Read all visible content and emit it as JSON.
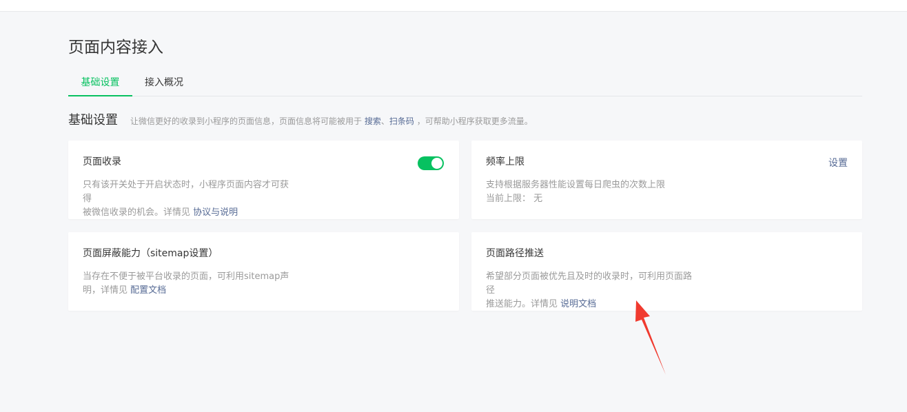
{
  "page_title": "页面内容接入",
  "tabs": [
    {
      "label": "基础设置",
      "active": true
    },
    {
      "label": "接入概况",
      "active": false
    }
  ],
  "section": {
    "title": "基础设置",
    "desc_prefix": "让微信更好的收录到小程序的页面信息，页面信息将可能被用于",
    "link_search": "搜索",
    "sep": "、",
    "link_scan": "扫条码",
    "desc_suffix": "，可帮助小程序获取更多流量。"
  },
  "cards": {
    "page_index": {
      "title": "页面收录",
      "desc_line1": "只有该开关处于开启状态时，小程序页面内容才可获得",
      "desc_line2_prefix": "被微信收录的机会。详情见 ",
      "link": "协议与说明",
      "toggle_on": true
    },
    "rate_limit": {
      "title": "频率上限",
      "set_label": "设置",
      "desc_line1": "支持根据服务器性能设置每日爬虫的次数上限",
      "limit_label": "当前上限：",
      "limit_value": "无"
    },
    "sitemap": {
      "title": "页面屏蔽能力（sitemap设置）",
      "desc_line1": "当存在不便于被平台收录的页面，可利用sitemap声",
      "desc_line2_prefix": "明，详情见 ",
      "link": "配置文档"
    },
    "path_push": {
      "title": "页面路径推送",
      "desc_line1": "希望部分页面被优先且及时的收录时，可利用页面路径",
      "desc_line2_prefix": "推送能力。详情见 ",
      "link": "说明文档"
    }
  },
  "colors": {
    "accent": "#07c160",
    "link": "#576b95",
    "annotation_arrow": "#f03a2f"
  }
}
